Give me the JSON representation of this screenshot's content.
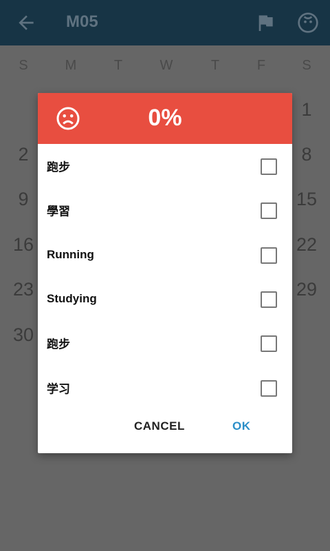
{
  "appbar": {
    "title": "M05",
    "icons": [
      "back-arrow-icon",
      "flag-icon",
      "face-icon"
    ]
  },
  "calendar": {
    "weekdays": [
      "S",
      "M",
      "T",
      "W",
      "T",
      "F",
      "S"
    ],
    "visible_days": {
      "right": [
        "1",
        "8",
        "15",
        "22",
        "29"
      ],
      "left": [
        "2",
        "9",
        "16",
        "23",
        "30"
      ]
    }
  },
  "dialog": {
    "percent": "0%",
    "icon": "sad-face-icon",
    "items": [
      {
        "label": "跑步",
        "checked": false
      },
      {
        "label": "學習",
        "checked": false
      },
      {
        "label": "Running",
        "checked": false
      },
      {
        "label": "Studying",
        "checked": false
      },
      {
        "label": "跑步",
        "checked": false
      },
      {
        "label": "学习",
        "checked": false
      }
    ],
    "cancel_label": "CANCEL",
    "ok_label": "OK"
  },
  "colors": {
    "appbar": "#173445",
    "dialog_header": "#e84e40",
    "accent": "#2a8ec8",
    "dim": "#666666"
  }
}
